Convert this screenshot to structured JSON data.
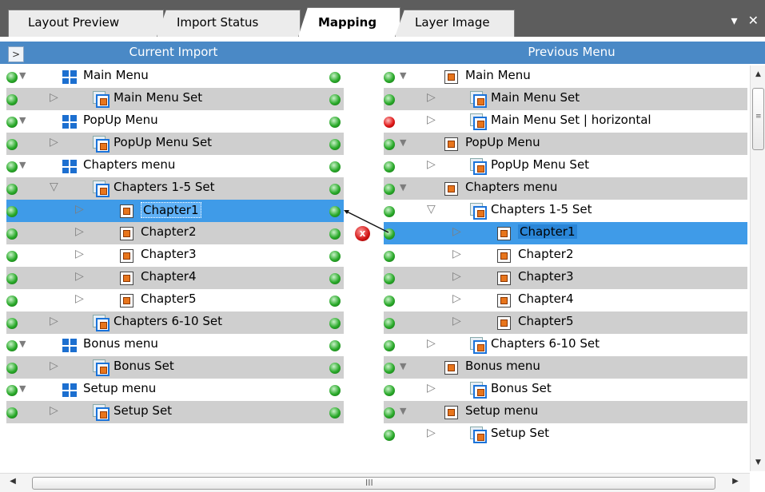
{
  "tabs": [
    {
      "label": "Layout Preview",
      "active": false
    },
    {
      "label": "Import Status",
      "active": false
    },
    {
      "label": "Mapping",
      "active": true
    },
    {
      "label": "Layer Image",
      "active": false
    }
  ],
  "tab_controls": {
    "menu_glyph": "▾",
    "close_glyph": "✕"
  },
  "columns": {
    "expand_label": ">",
    "left": "Current Import",
    "right": "Previous Menu"
  },
  "left_tree": [
    {
      "label": "Main Menu",
      "type": "menu",
      "depth": 0,
      "expanded": true,
      "status": "green"
    },
    {
      "label": "Main Menu Set",
      "type": "set",
      "depth": 1,
      "expanded": false,
      "status": "green"
    },
    {
      "label": "PopUp Menu",
      "type": "menu",
      "depth": 0,
      "expanded": true,
      "status": "green"
    },
    {
      "label": "PopUp Menu Set",
      "type": "set",
      "depth": 1,
      "expanded": false,
      "status": "green"
    },
    {
      "label": "Chapters menu",
      "type": "menu",
      "depth": 0,
      "expanded": true,
      "status": "green"
    },
    {
      "label": "Chapters 1-5 Set",
      "type": "set",
      "depth": 1,
      "expanded": true,
      "status": "green"
    },
    {
      "label": "Chapter1",
      "type": "item",
      "depth": 2,
      "expanded": false,
      "status": "green",
      "selected": true
    },
    {
      "label": "Chapter2",
      "type": "item",
      "depth": 2,
      "expanded": false,
      "status": "green"
    },
    {
      "label": "Chapter3",
      "type": "item",
      "depth": 2,
      "expanded": false,
      "status": "green"
    },
    {
      "label": "Chapter4",
      "type": "item",
      "depth": 2,
      "expanded": false,
      "status": "green"
    },
    {
      "label": "Chapter5",
      "type": "item",
      "depth": 2,
      "expanded": false,
      "status": "green"
    },
    {
      "label": "Chapters 6-10 Set",
      "type": "set",
      "depth": 1,
      "expanded": false,
      "status": "green"
    },
    {
      "label": "Bonus menu",
      "type": "menu",
      "depth": 0,
      "expanded": true,
      "status": "green"
    },
    {
      "label": "Bonus Set",
      "type": "set",
      "depth": 1,
      "expanded": false,
      "status": "green"
    },
    {
      "label": "Setup menu",
      "type": "menu",
      "depth": 0,
      "expanded": true,
      "status": "green"
    },
    {
      "label": "Setup Set",
      "type": "set",
      "depth": 1,
      "expanded": false,
      "status": "green"
    }
  ],
  "right_tree": [
    {
      "label": "Main Menu",
      "type": "menu",
      "depth": 0,
      "expanded": true,
      "status": "green"
    },
    {
      "label": "Main Menu Set",
      "type": "set",
      "depth": 1,
      "expanded": false,
      "status": "green"
    },
    {
      "label": "Main Menu Set | horizontal",
      "type": "set",
      "depth": 1,
      "expanded": false,
      "status": "red"
    },
    {
      "label": "PopUp Menu",
      "type": "menu",
      "depth": 0,
      "expanded": true,
      "status": "green"
    },
    {
      "label": "PopUp Menu Set",
      "type": "set",
      "depth": 1,
      "expanded": false,
      "status": "green"
    },
    {
      "label": "Chapters menu",
      "type": "menu",
      "depth": 0,
      "expanded": true,
      "status": "green"
    },
    {
      "label": "Chapters 1-5 Set",
      "type": "set",
      "depth": 1,
      "expanded": true,
      "status": "green"
    },
    {
      "label": "Chapter1",
      "type": "item",
      "depth": 2,
      "expanded": false,
      "status": "green",
      "selected": true
    },
    {
      "label": "Chapter2",
      "type": "item",
      "depth": 2,
      "expanded": false,
      "status": "green"
    },
    {
      "label": "Chapter3",
      "type": "item",
      "depth": 2,
      "expanded": false,
      "status": "green"
    },
    {
      "label": "Chapter4",
      "type": "item",
      "depth": 2,
      "expanded": false,
      "status": "green"
    },
    {
      "label": "Chapter5",
      "type": "item",
      "depth": 2,
      "expanded": false,
      "status": "green"
    },
    {
      "label": "Chapters 6-10 Set",
      "type": "set",
      "depth": 1,
      "expanded": false,
      "status": "green"
    },
    {
      "label": "Bonus menu",
      "type": "menu",
      "depth": 0,
      "expanded": true,
      "status": "green"
    },
    {
      "label": "Bonus Set",
      "type": "set",
      "depth": 1,
      "expanded": false,
      "status": "green"
    },
    {
      "label": "Setup menu",
      "type": "menu",
      "depth": 0,
      "expanded": true,
      "status": "green"
    },
    {
      "label": "Setup Set",
      "type": "set",
      "depth": 1,
      "expanded": false,
      "status": "green"
    }
  ],
  "mapping": {
    "error_glyph": "x"
  },
  "scrollbar": {
    "h_grip": "III",
    "v_grip": "≡"
  },
  "colors": {
    "header_blue": "#4a89c6",
    "selection_blue": "#3f9be8",
    "tab_bar": "#5d5d5d",
    "row_alt": "#cfcfcf"
  }
}
